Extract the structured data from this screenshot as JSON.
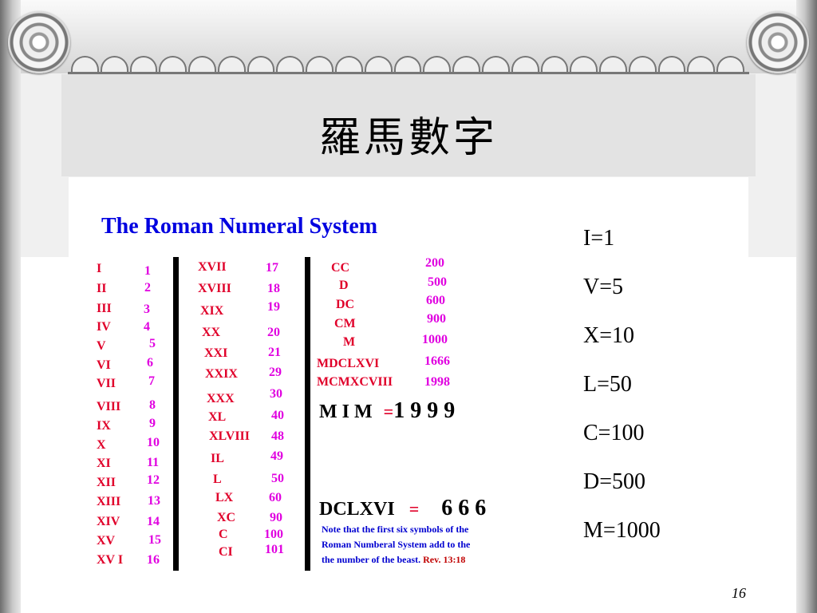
{
  "title": "羅馬數字",
  "subtitle": "The Roman Numeral System",
  "col1": [
    {
      "r": "I",
      "n": "1"
    },
    {
      "r": "II",
      "n": "2"
    },
    {
      "r": "III",
      "n": "3"
    },
    {
      "r": "IV",
      "n": "4"
    },
    {
      "r": "V",
      "n": "5"
    },
    {
      "r": "VI",
      "n": "6"
    },
    {
      "r": "VII",
      "n": "7"
    },
    {
      "r": "VIII",
      "n": "8"
    },
    {
      "r": "IX",
      "n": "9"
    },
    {
      "r": "X",
      "n": "10"
    },
    {
      "r": "XI",
      "n": "11"
    },
    {
      "r": "XII",
      "n": "12"
    },
    {
      "r": "XIII",
      "n": "13"
    },
    {
      "r": "XIV",
      "n": "14"
    },
    {
      "r": "XV",
      "n": "15"
    },
    {
      "r": "XV I",
      "n": "16"
    }
  ],
  "col2": [
    {
      "r": "XVII",
      "n": "17"
    },
    {
      "r": "XVIII",
      "n": "18"
    },
    {
      "r": "XIX",
      "n": "19"
    },
    {
      "r": "XX",
      "n": "20"
    },
    {
      "r": "XXI",
      "n": "21"
    },
    {
      "r": "XXIX",
      "n": "29"
    },
    {
      "r": "XXX",
      "n": "30"
    },
    {
      "r": "XL",
      "n": "40"
    },
    {
      "r": "XLVIII",
      "n": "48"
    },
    {
      "r": "IL",
      "n": "49"
    },
    {
      "r": "L",
      "n": "50"
    },
    {
      "r": "LX",
      "n": "60"
    },
    {
      "r": "XC",
      "n": "90"
    },
    {
      "r": "C",
      "n": "100"
    },
    {
      "r": "CI",
      "n": "101"
    }
  ],
  "col3": [
    {
      "r": "CC",
      "n": "200"
    },
    {
      "r": "D",
      "n": "500"
    },
    {
      "r": "DC",
      "n": "600"
    },
    {
      "r": "CM",
      "n": "900"
    },
    {
      "r": "M",
      "n": "1000"
    },
    {
      "r": "MDCLXVI",
      "n": "1666"
    },
    {
      "r": "MCMXCVIII",
      "n": "1998"
    }
  ],
  "eq1": {
    "lhs": "M I M",
    "sign": "=",
    "rhs": "1 9 9 9"
  },
  "eq2": {
    "lhs": "DCLXVI",
    "sign": "=",
    "rhs": "6 6 6"
  },
  "note": [
    "Note that the first six symbols of the",
    "Roman Numberal System add to the",
    "the number of the beast."
  ],
  "rev": "Rev.   13:18",
  "values": [
    "I=1",
    "V=5",
    "X=10",
    "L=50",
    "C=100",
    "D=500",
    "M=1000"
  ],
  "page_number": "16"
}
